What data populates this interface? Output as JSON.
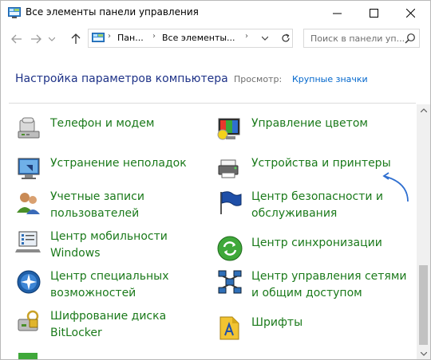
{
  "window": {
    "title": "Все элементы панели управления"
  },
  "address": {
    "crumbs": [
      "Пан...",
      "Все элементы..."
    ],
    "search_placeholder": "Поиск в панели уп..."
  },
  "header": {
    "title": "Настройка параметров компьютера",
    "view_by_label": "Просмотр:",
    "view_by_value": "Крупные значки"
  },
  "items_left": [
    {
      "label": "Телефон и модем",
      "icon": "phone-modem-icon"
    },
    {
      "label": "Устранение неполадок",
      "icon": "troubleshooting-icon"
    },
    {
      "label": "Учетные записи\nпользователей",
      "icon": "user-accounts-icon"
    },
    {
      "label": "Центр мобильности\nWindows",
      "icon": "mobility-center-icon"
    },
    {
      "label": "Центр специальных\nвозможностей",
      "icon": "ease-of-access-icon"
    },
    {
      "label": "Шифрование диска\nBitLocker",
      "icon": "bitlocker-icon"
    }
  ],
  "items_right": [
    {
      "label": "Управление цветом",
      "icon": "color-management-icon"
    },
    {
      "label": "Устройства и принтеры",
      "icon": "devices-printers-icon"
    },
    {
      "label": "Центр безопасности и\nобслуживания",
      "icon": "security-maintenance-icon"
    },
    {
      "label": "Центр синхронизации",
      "icon": "sync-center-icon"
    },
    {
      "label": "Центр управления сетями\nи общим доступом",
      "icon": "network-center-icon"
    },
    {
      "label": "Шрифты",
      "icon": "fonts-icon"
    }
  ],
  "colors": {
    "link_green": "#1b7a1b",
    "heading_blue": "#1e3287",
    "annotation": "#2f6fd0"
  }
}
